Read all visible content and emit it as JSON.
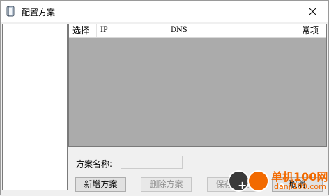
{
  "window": {
    "title": "配置方案"
  },
  "table": {
    "columns": [
      "选择",
      "IP",
      "DNS",
      "常项"
    ]
  },
  "form": {
    "name_label": "方案名称:",
    "name_value": ""
  },
  "buttons": {
    "add": "新增方案",
    "delete": "删除方案",
    "save": "保存方案",
    "cancel": "取消"
  },
  "watermark": {
    "title": "单机100网",
    "url": "danji100.com"
  },
  "colors": {
    "table_body": "#ababab",
    "watermark": "#f26a00"
  }
}
